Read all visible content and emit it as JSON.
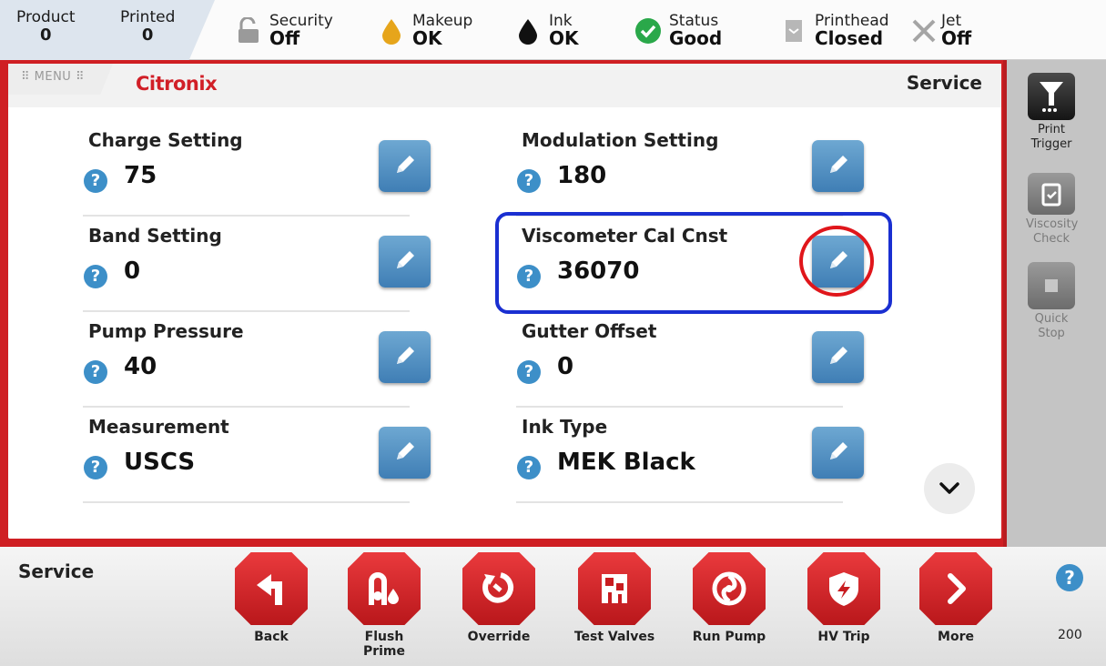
{
  "topbar": {
    "product": {
      "label": "Product",
      "value": "0"
    },
    "printed": {
      "label": "Printed",
      "value": "0"
    },
    "security": {
      "label": "Security",
      "value": "Off"
    },
    "makeup": {
      "label": "Makeup",
      "value": "OK"
    },
    "ink": {
      "label": "Ink",
      "value": "OK"
    },
    "status": {
      "label": "Status",
      "value": "Good"
    },
    "printhead": {
      "label": "Printhead",
      "value": "Closed"
    },
    "jet": {
      "label": "Jet",
      "value": "Off"
    }
  },
  "header": {
    "menu_label": "MENU",
    "logo_text": "Citronix",
    "page_title": "Service"
  },
  "settings": [
    {
      "name": "Charge Setting",
      "value": "75"
    },
    {
      "name": "Modulation Setting",
      "value": "180"
    },
    {
      "name": "Band Setting",
      "value": "0"
    },
    {
      "name": "Viscometer Cal Cnst",
      "value": "36070"
    },
    {
      "name": "Pump Pressure",
      "value": "40"
    },
    {
      "name": "Gutter Offset",
      "value": "0"
    },
    {
      "name": "Measurement",
      "value": "USCS"
    },
    {
      "name": "Ink Type",
      "value": "MEK Black"
    }
  ],
  "help_symbol": "?",
  "sidepanel": [
    {
      "label": "Print Trigger",
      "icon": "print-trigger-icon",
      "enabled": true
    },
    {
      "label": "Viscosity Check",
      "icon": "viscosity-check-icon",
      "enabled": false
    },
    {
      "label": "Quick Stop",
      "icon": "stop-icon",
      "enabled": false
    }
  ],
  "bottombar": {
    "title": "Service",
    "buttons": [
      {
        "label": "Back",
        "icon": "back-arrow-icon"
      },
      {
        "label": "Flush Prime",
        "icon": "flush-prime-icon"
      },
      {
        "label": "Override",
        "icon": "override-icon"
      },
      {
        "label": "Test Valves",
        "icon": "test-valves-icon"
      },
      {
        "label": "Run Pump",
        "icon": "run-pump-icon"
      },
      {
        "label": "HV Trip",
        "icon": "hv-trip-icon"
      },
      {
        "label": "More",
        "icon": "chevron-right-icon"
      }
    ],
    "version": "200"
  },
  "colors": {
    "frame_red": "#cf1f23",
    "edit_blue": "#3f7eb5",
    "help_blue": "#3d8fc8",
    "highlight_box": "#1a2fd1",
    "highlight_circle": "#e0161b",
    "status_green": "#2aa84a",
    "makeup_amber": "#e6a51b"
  }
}
